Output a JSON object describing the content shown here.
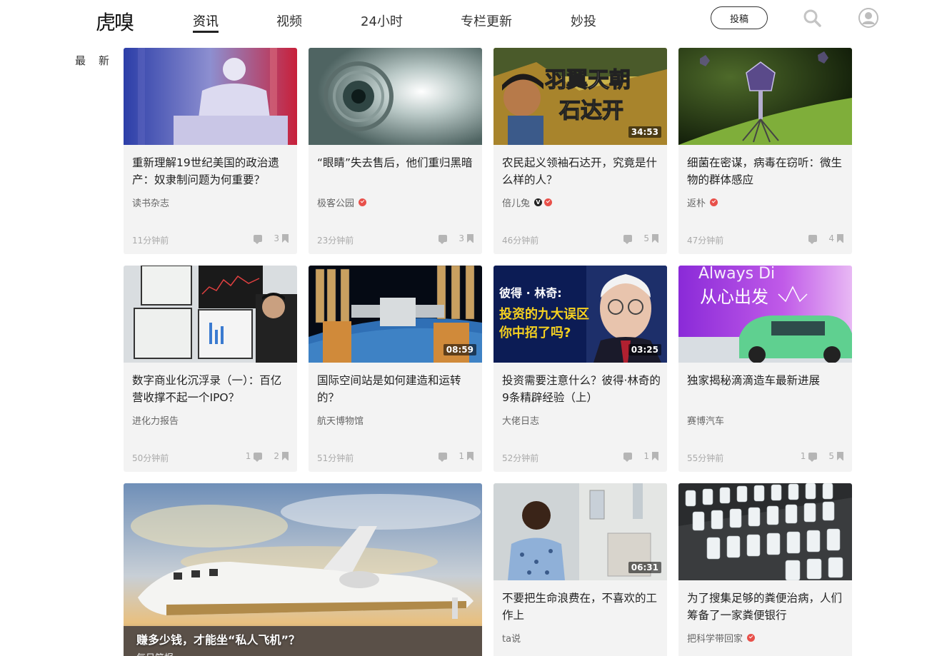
{
  "header": {
    "logo": "虎嗅",
    "nav": [
      "资讯",
      "视频",
      "24小时",
      "专栏更新",
      "妙投"
    ],
    "active_nav": 0,
    "contribute_label": "投稿"
  },
  "side_label": "最新",
  "cards": [
    {
      "title": "重新理解19世纪美国的政治遗产：奴隶制问题为何重要？",
      "author": "读书杂志",
      "verified": false,
      "time": "11分钟前",
      "comments": "",
      "bookmarks": "3",
      "duration": ""
    },
    {
      "title": "“眼睛”失去售后，他们重归黑暗",
      "author": "极客公园",
      "verified": true,
      "time": "23分钟前",
      "comments": "",
      "bookmarks": "3",
      "duration": ""
    },
    {
      "title": "农民起义领袖石达开，究竟是什么样的人？",
      "author": "倍儿兔",
      "verified": true,
      "v_badge": "V",
      "time": "46分钟前",
      "comments": "",
      "bookmarks": "5",
      "duration": "34:53",
      "thumb_text_1": "羽翼天朝",
      "thumb_text_2": "石达开"
    },
    {
      "title": "细菌在密谋，病毒在窃听：微生物的群体感应",
      "author": "返朴",
      "verified": true,
      "time": "47分钟前",
      "comments": "",
      "bookmarks": "4",
      "duration": ""
    },
    {
      "title": "数字商业化沉浮录（一）：百亿营收撑不起一个IPO？",
      "author": "进化力报告",
      "verified": false,
      "time": "50分钟前",
      "comments": "1",
      "bookmarks": "2",
      "duration": ""
    },
    {
      "title": "国际空间站是如何建造和运转的？",
      "author": "航天博物馆",
      "verified": false,
      "time": "51分钟前",
      "comments": "",
      "bookmarks": "1",
      "duration": "08:59"
    },
    {
      "title": "投资需要注意什么？彼得·林奇的9条精辟经验（上）",
      "author": "大佬日志",
      "verified": false,
      "time": "52分钟前",
      "comments": "",
      "bookmarks": "1",
      "duration": "03:25",
      "thumb_text_1": "彼得 · 林奇:",
      "thumb_text_2": "投资的九大误区",
      "thumb_text_3": "你中招了吗?"
    },
    {
      "title": "独家揭秘滴滴造车最新进展",
      "author": "赛博汽车",
      "verified": false,
      "time": "55分钟前",
      "comments": "1",
      "bookmarks": "5",
      "duration": "",
      "thumb_text_1": "Always Di",
      "thumb_text_2": "从心出发"
    },
    {
      "title": "不要把生命浪费在，不喜欢的工作上",
      "author": "ta说",
      "verified": false,
      "time": "",
      "comments": "",
      "bookmarks": "",
      "duration": "06:31"
    },
    {
      "title": "为了搜集足够的粪便治病，人们筹备了一家粪便银行",
      "author": "把科学带回家",
      "verified": true,
      "time": "",
      "comments": "",
      "bookmarks": "",
      "duration": ""
    }
  ],
  "big_card": {
    "title": "赚多少钱，才能坐“私人飞机”？",
    "author": "每日简报"
  },
  "colors": {
    "accent": "#e8504a",
    "card_bg": "#f3f3f3"
  }
}
